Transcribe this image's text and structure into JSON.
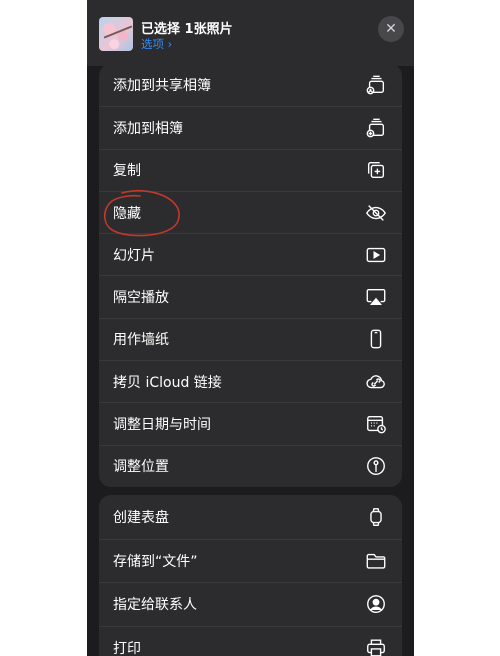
{
  "header": {
    "title": "已选择 1张照片",
    "options_label": "选项 ›"
  },
  "group1": [
    {
      "label": "添加到共享相簿",
      "icon": "shared-album-icon"
    },
    {
      "label": "添加到相簿",
      "icon": "add-to-album-icon"
    },
    {
      "label": "复制",
      "icon": "duplicate-icon"
    },
    {
      "label": "隐藏",
      "icon": "hide-eye-icon"
    },
    {
      "label": "幻灯片",
      "icon": "slideshow-play-icon"
    },
    {
      "label": "隔空播放",
      "icon": "airplay-icon"
    },
    {
      "label": "用作墙纸",
      "icon": "phone-wallpaper-icon"
    },
    {
      "label": "拷贝 iCloud 链接",
      "icon": "link-cloud-icon"
    },
    {
      "label": "调整日期与时间",
      "icon": "calendar-clock-icon"
    },
    {
      "label": "调整位置",
      "icon": "location-pin-icon"
    }
  ],
  "group2": [
    {
      "label": "创建表盘",
      "icon": "watch-icon"
    },
    {
      "label": "存储到“文件”",
      "icon": "folder-icon"
    },
    {
      "label": "指定给联系人",
      "icon": "contact-person-icon"
    },
    {
      "label": "打印",
      "icon": "printer-icon"
    }
  ],
  "colors": {
    "background": "#1c1c1e",
    "card": "#2c2c2e",
    "accent": "#2f8bff",
    "annotation": "#c0392b"
  }
}
